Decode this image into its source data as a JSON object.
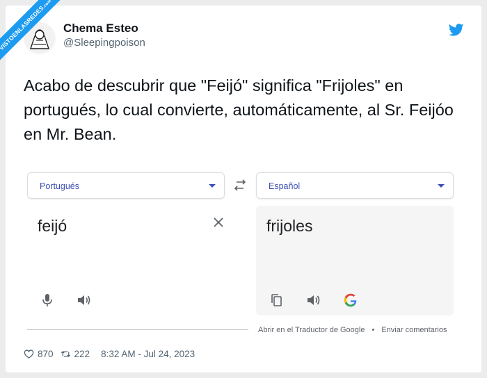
{
  "watermark": {
    "main": "VISTOENLASREDES",
    "sub": ".com"
  },
  "author": {
    "name": "Chema Esteo",
    "handle": "@Sleepingpoison"
  },
  "tweet": {
    "text": "Acabo de descubrir que \"Feijó\" significa \"Frijoles\" en portugués, lo cual convierte, automáticamente, al Sr. Feijóo en Mr. Bean."
  },
  "translator": {
    "source_lang": "Portugués",
    "target_lang": "Español",
    "source_text": "feijó",
    "target_text": "frijoles",
    "open_link": "Abrir en el Traductor de Google",
    "separator": "•",
    "feedback_link": "Enviar comentarios"
  },
  "stats": {
    "likes": "870",
    "retweets": "222",
    "timestamp": "8:32 AM - Jul 24, 2023"
  },
  "colors": {
    "twitter_blue": "#1d9bf0",
    "translate_blue": "#3c4fb5"
  }
}
